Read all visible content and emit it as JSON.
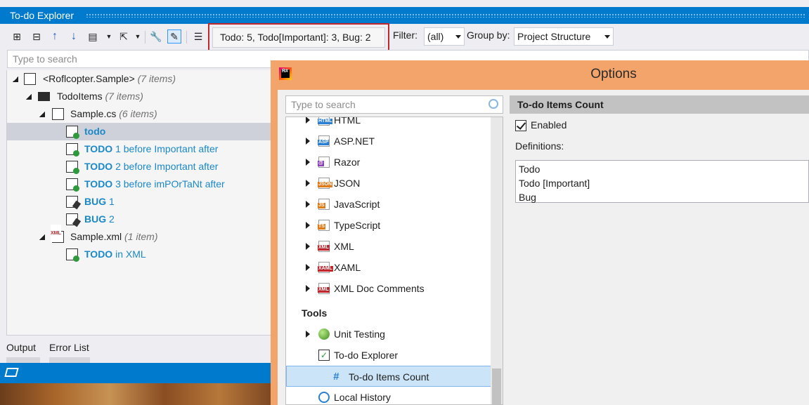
{
  "explorer": {
    "title": "To-do Explorer",
    "counts": "Todo: 5, Todo[Important]: 3, Bug: 2",
    "filter_label": "Filter:",
    "filter_value": "(all)",
    "groupby_label": "Group by:",
    "groupby_value": "Project Structure",
    "search_placeholder": "Type to search",
    "tree": {
      "project": {
        "label": "<Roflcopter.Sample>",
        "count": "(7 items)"
      },
      "folder": {
        "label": "TodoItems",
        "count": "(7 items)"
      },
      "file_cs": {
        "label": "Sample.cs",
        "count": "(6 items)"
      },
      "items": [
        {
          "keyword": "todo",
          "rest": ""
        },
        {
          "keyword": "TODO",
          "rest": " 1 before Important after"
        },
        {
          "keyword": "TODO",
          "rest": " 2 before Important after"
        },
        {
          "keyword": "TODO",
          "rest": " 3 before imPOrTaNt after"
        },
        {
          "keyword": "BUG",
          "rest": " 1"
        },
        {
          "keyword": "BUG",
          "rest": " 2"
        }
      ],
      "file_xml": {
        "label": "Sample.xml",
        "count": "(1 item)"
      },
      "xml_item": {
        "keyword": "TODO",
        "rest": " in XML"
      }
    },
    "bottom_tabs": [
      "Output",
      "Error List"
    ]
  },
  "options": {
    "title": "Options",
    "search_placeholder": "Type to search",
    "tree": [
      {
        "label": "HTML",
        "icon": "html-icon",
        "color": "#2a7fd4"
      },
      {
        "label": "ASP.NET",
        "icon": "aspnet-icon",
        "color": "#2a7fd4"
      },
      {
        "label": "Razor",
        "icon": "razor-icon",
        "color": "#8a3fb3"
      },
      {
        "label": "JSON",
        "icon": "json-icon",
        "color": "#e07b1a"
      },
      {
        "label": "JavaScript",
        "icon": "javascript-icon",
        "color": "#e07b1a"
      },
      {
        "label": "TypeScript",
        "icon": "typescript-icon",
        "color": "#e07b1a"
      },
      {
        "label": "XML",
        "icon": "xml-icon",
        "color": "#c0282e"
      },
      {
        "label": "XAML",
        "icon": "xaml-icon",
        "color": "#c0282e"
      },
      {
        "label": "XML Doc Comments",
        "icon": "xml-doc-icon",
        "color": "#c0282e"
      }
    ],
    "tools_label": "Tools",
    "tools_items": {
      "unit_testing": "Unit Testing",
      "todo_explorer": "To-do Explorer",
      "todo_count": "To-do Items Count",
      "local_history": "Local History"
    },
    "panel": {
      "header": "To-do Items Count",
      "enabled_label": "Enabled",
      "enabled": true,
      "definitions_label": "Definitions:",
      "definitions": [
        "Todo",
        "Todo [Important]",
        "Bug"
      ]
    }
  },
  "colors": {
    "accent": "#007acc",
    "link": "#1a88c9",
    "dialog_frame": "#f3a46a",
    "highlight_box": "#c0282e"
  }
}
